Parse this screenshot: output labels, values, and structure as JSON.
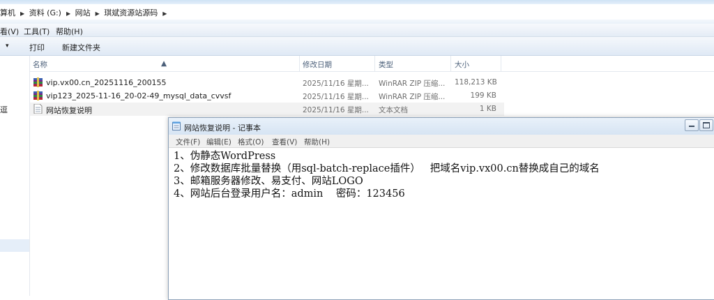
{
  "explorer": {
    "breadcrumb": [
      "算机",
      "资料 (G:)",
      "网站",
      "琪斌资源站源码"
    ],
    "menu": [
      "看(V)",
      "工具(T)",
      "帮助(H)"
    ],
    "toolbar": {
      "arrow": "▾",
      "print": "打印",
      "new_folder": "新建文件夹"
    },
    "sidebar_glyph": "逗",
    "columns": {
      "name": "名称",
      "date": "修改日期",
      "type": "类型",
      "size": "大小"
    },
    "files": [
      {
        "name": "vip.vx00.cn_20251116_200155",
        "date": "2025/11/16 星期...",
        "type": "WinRAR ZIP 压缩...",
        "size": "118,213 KB",
        "icon": "winrar-archive-icon"
      },
      {
        "name": "vip123_2025-11-16_20-02-49_mysql_data_cvvsf",
        "date": "2025/11/16 星期...",
        "type": "WinRAR ZIP 压缩...",
        "size": "199 KB",
        "icon": "winrar-archive-icon"
      },
      {
        "name": "网站恢复说明",
        "date": "2025/11/16 星期...",
        "type": "文本文档",
        "size": "1 KB",
        "icon": "text-document-icon"
      }
    ]
  },
  "notepad": {
    "title": "网站恢复说明 - 记事本",
    "menu": [
      "文件(F)",
      "编辑(E)",
      "格式(O)",
      "查看(V)",
      "帮助(H)"
    ],
    "lines": [
      "1、伪静态WordPress",
      "2、修改数据库批量替换（用sql-batch-replace插件）   把域名vip.vx00.cn替换成自己的域名",
      "3、邮箱服务器修改、易支付、网站LOGO",
      "4、网站后台登录用户名：admin    密码：123456"
    ]
  }
}
